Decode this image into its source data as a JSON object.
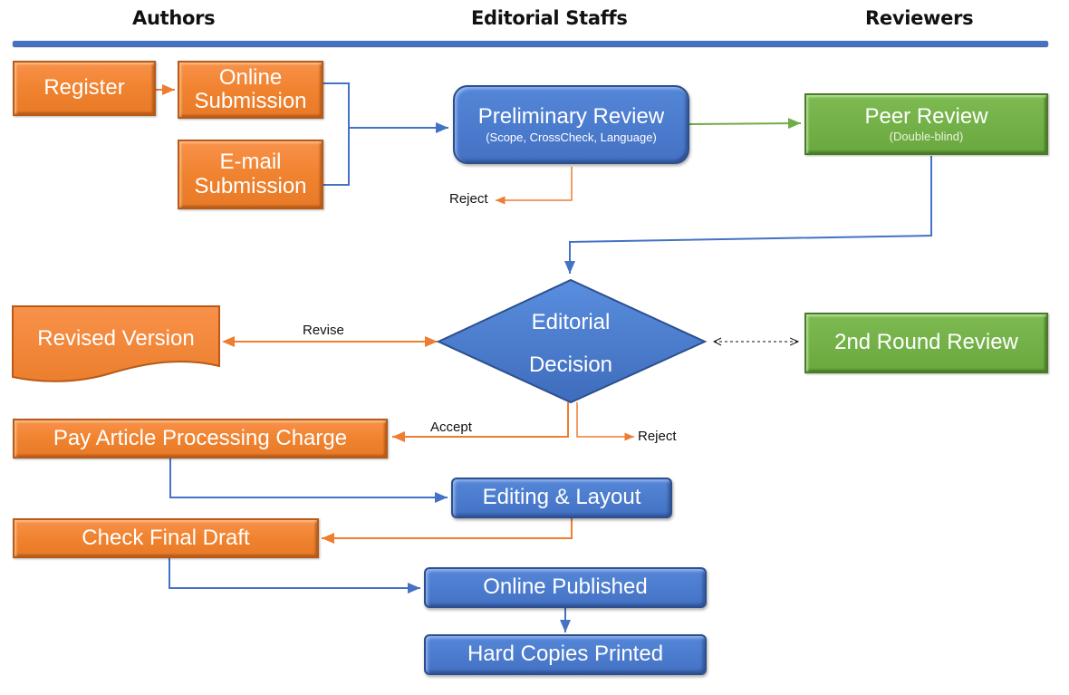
{
  "lanes": {
    "authors": "Authors",
    "editorial": "Editorial Staffs",
    "reviewers": "Reviewers"
  },
  "nodes": {
    "register": "Register",
    "online_submission": [
      "Online",
      "Submission"
    ],
    "email_submission": [
      "E-mail",
      "Submission"
    ],
    "preliminary_review": {
      "title": "Preliminary Review",
      "subtitle": "(Scope, CrossCheck, Language)"
    },
    "peer_review": {
      "title": "Peer Review",
      "subtitle": "(Double-blind)"
    },
    "editorial_decision": [
      "Editorial",
      "Decision"
    ],
    "revised_version": "Revised Version",
    "second_round_review": "2nd Round Review",
    "pay_apc": "Pay Article Processing Charge",
    "editing_layout": "Editing & Layout",
    "check_final_draft": "Check Final Draft",
    "online_published": "Online Published",
    "hard_copies_printed": "Hard Copies Printed"
  },
  "edge_labels": {
    "reject_preliminary": "Reject",
    "revise": "Revise",
    "accept": "Accept",
    "reject_decision": "Reject"
  },
  "colors": {
    "author_step": "#f0832f",
    "editorial_step": "#4472c4",
    "reviewer_step": "#6aa83f",
    "lane_rule": "#4472c4"
  }
}
